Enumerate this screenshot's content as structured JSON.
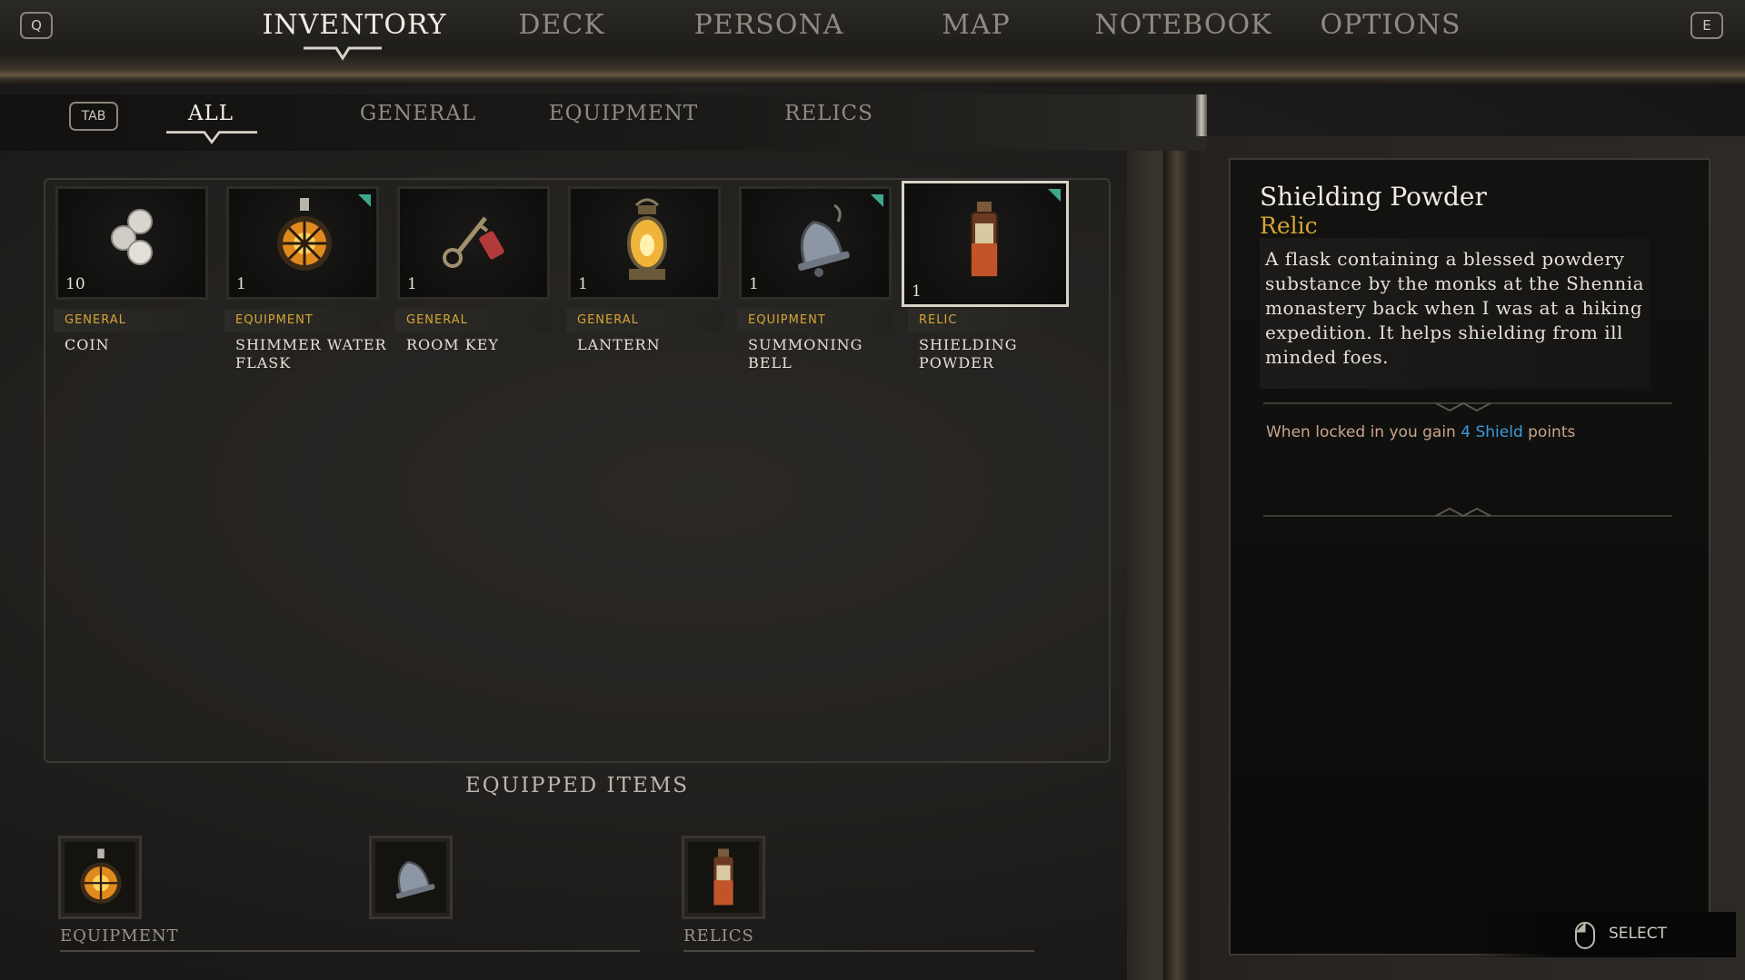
{
  "top_nav": {
    "left_key": "Q",
    "right_key": "E",
    "tabs": [
      {
        "label": "INVENTORY",
        "active": true
      },
      {
        "label": "DECK",
        "active": false
      },
      {
        "label": "PERSONA",
        "active": false
      },
      {
        "label": "MAP",
        "active": false
      },
      {
        "label": "NOTEBOOK",
        "active": false
      },
      {
        "label": "OPTIONS",
        "active": false
      }
    ]
  },
  "sub_nav": {
    "key": "TAB",
    "tabs": [
      {
        "label": "ALL",
        "active": true
      },
      {
        "label": "GENERAL",
        "active": false
      },
      {
        "label": "EQUIPMENT",
        "active": false
      },
      {
        "label": "RELICS",
        "active": false
      }
    ]
  },
  "items": [
    {
      "name": "COIN",
      "category": "GENERAL",
      "qty": "10",
      "icon": "coin-icon",
      "new": false,
      "selected": false
    },
    {
      "name": "SHIMMER WATER FLASK",
      "category": "EQUIPMENT",
      "qty": "1",
      "icon": "flask-icon",
      "new": true,
      "selected": false
    },
    {
      "name": "ROOM KEY",
      "category": "GENERAL",
      "qty": "1",
      "icon": "key-icon",
      "new": false,
      "selected": false
    },
    {
      "name": "LANTERN",
      "category": "GENERAL",
      "qty": "1",
      "icon": "lantern-icon",
      "new": false,
      "selected": false
    },
    {
      "name": "SUMMONING BELL",
      "category": "EQUIPMENT",
      "qty": "1",
      "icon": "bell-icon",
      "new": true,
      "selected": false
    },
    {
      "name": "SHIELDING POWDER",
      "category": "RELIC",
      "qty": "1",
      "icon": "bottle-icon",
      "new": true,
      "selected": true
    }
  ],
  "equipped": {
    "title": "EQUIPPED ITEMS",
    "equipment_label": "EQUIPMENT",
    "relics_label": "RELICS"
  },
  "detail": {
    "name": "Shielding Powder",
    "type": "Relic",
    "description": "A flask containing a blessed powdery substance by the monks at the Shennia monastery back when I was at a hiking expedition. It helps shielding from ill minded foes.",
    "effect_prefix": "When locked in you gain ",
    "effect_highlight": "4 Shield",
    "effect_suffix": " points"
  },
  "hint": {
    "label": "SELECT",
    "icon": "mouse-icon"
  },
  "colors": {
    "accent_gold": "#d6a636",
    "highlight_blue": "#3b9bd8",
    "new_flag": "#3fa78c"
  }
}
